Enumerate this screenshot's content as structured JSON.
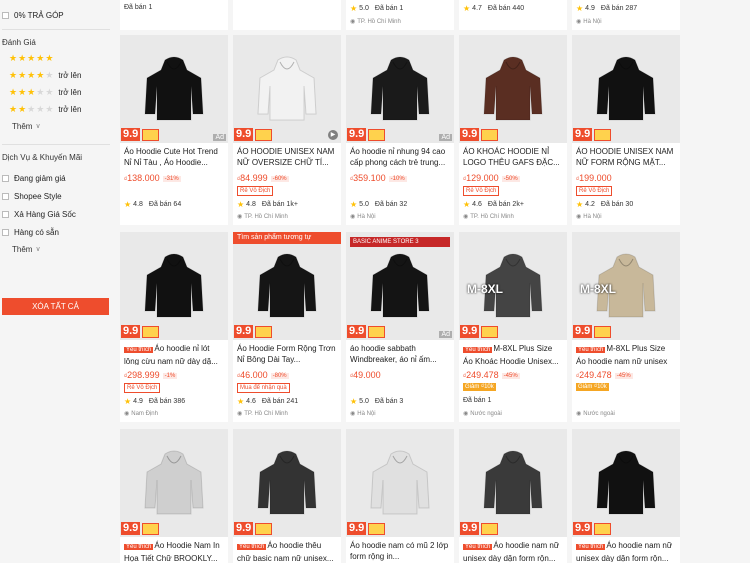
{
  "sidebar": {
    "tra_gop": "0% TRẢ GÓP",
    "rating_title": "Đánh Giá",
    "ratings": [
      {
        "stars": 5,
        "label": ""
      },
      {
        "stars": 4,
        "label": "trở lên"
      },
      {
        "stars": 3,
        "label": "trở lên"
      },
      {
        "stars": 2,
        "label": "trở lên"
      }
    ],
    "more_label": "Thêm",
    "services_title": "Dịch Vụ & Khuyến Mãi",
    "services": [
      "Đang giảm giá",
      "Shopee Style",
      "Xả Hàng Giá Sốc",
      "Hàng có sẵn"
    ],
    "services_more": "Thêm",
    "clear_all": "XÓA TẤT CẢ",
    "accent": "#ee4d2d"
  },
  "top_row": [
    {
      "rating": "",
      "sold": "Đã bán 1",
      "location": ""
    },
    {
      "rating": "5.0",
      "sold": "Đã bán 1",
      "location": "TP. Hồ Chí Minh"
    },
    {
      "rating": "4.7",
      "sold": "Đã bán 440",
      "location": ""
    },
    {
      "rating": "4.9",
      "sold": "Đã bán 287",
      "location": "Hà Nội"
    }
  ],
  "products": [
    {
      "title": "Áo Hoodie Cute Hot Trend Nỉ Nỉ Tàu , Áo Hoodie...",
      "mall": false,
      "price": "138.000",
      "discount": "-31%",
      "tag": "",
      "tag_style": "",
      "rating": "4.8",
      "sold": "Đã bán 64",
      "location": "",
      "banner": "",
      "overlay": "ad",
      "color": "#111"
    },
    {
      "title": "ÁO HOODIE UNISEX NAM NỮ OVERSIZE CHỮ TÍ...",
      "mall": false,
      "price": "84.999",
      "discount": "-60%",
      "tag": "Rẻ Vô Địch",
      "tag_style": "box",
      "rating": "4.8",
      "sold": "Đã bán 1k+",
      "location": "TP. Hồ Chí Minh",
      "banner": "",
      "overlay": "play",
      "color": "#f2f2f2"
    },
    {
      "title": "Áo hoodie nỉ nhung 94 cao cấp phong cách trẻ trung...",
      "mall": false,
      "price": "359.100",
      "discount": "-10%",
      "tag": "",
      "tag_style": "",
      "rating": "5.0",
      "sold": "Đã bán 32",
      "location": "Hà Nội",
      "banner": "",
      "overlay": "ad",
      "color": "#1a1a1a"
    },
    {
      "title": "ÁO KHOÁC HOODIE NỈ LOGO THÊU GAFS ĐẶC...",
      "mall": false,
      "price": "129.000",
      "discount": "-50%",
      "tag": "Rẻ Vô Địch",
      "tag_style": "box",
      "rating": "4.6",
      "sold": "Đã bán 2k+",
      "location": "TP. Hồ Chí Minh",
      "banner": "",
      "overlay": "",
      "color": "#5a2e22"
    },
    {
      "title": "ÁO HOODIE UNISEX NAM NỮ FORM RỘNG MẶT...",
      "mall": false,
      "price": "199.000",
      "discount": "",
      "tag": "Rẻ Vô Địch",
      "tag_style": "box",
      "rating": "4.2",
      "sold": "Đã bán 30",
      "location": "Hà Nội",
      "banner": "",
      "overlay": "",
      "color": "#111"
    },
    {
      "title": "Áo hoodie nỉ lót lông cừu nam nữ dày dặ...",
      "mall": true,
      "price": "298.999",
      "discount": "-1%",
      "tag": "Rẻ Vô Địch",
      "tag_style": "box",
      "rating": "4.9",
      "sold": "Đã bán 386",
      "location": "Nam Định",
      "banner": "",
      "overlay": "",
      "color": "#111"
    },
    {
      "title": "Áo Hoodie Form Rộng Trơn Nỉ Bông Dài Tay...",
      "mall": false,
      "price": "46.000",
      "discount": "-80%",
      "tag": "Mua để nhận quà",
      "tag_style": "box",
      "rating": "4.6",
      "sold": "Đã bán 241",
      "location": "TP. Hồ Chí Minh",
      "banner": "Tìm sản phẩm tương tự",
      "overlay": "",
      "color": "#151515"
    },
    {
      "title": "áo hoodie sabbath Windbreaker, áo nỉ ấm...",
      "mall": false,
      "price": "49.000",
      "discount": "",
      "tag": "",
      "tag_style": "",
      "rating": "5.0",
      "sold": "Đã bán 3",
      "location": "Hà Nội",
      "banner": "BASIC ANIME STORE 3",
      "overlay": "ad",
      "color": "#141414"
    },
    {
      "title": "M-8XL Plus Size Áo Khoác Hoodie Unisex...",
      "mall": true,
      "price": "249.478",
      "discount": "-45%",
      "tag": "Giảm ₫10k",
      "tag_style": "fill",
      "rating": "",
      "sold": "Đã bán 1",
      "location": "Nước ngoài",
      "banner": "",
      "overlay": "",
      "size_tag": "M-8XL",
      "color": "#444"
    },
    {
      "title": "M-8XL Plus Size Áo hoodie nam nữ unisex có mũ trùm đầ...",
      "mall": true,
      "price": "249.478",
      "discount": "-45%",
      "tag": "Giảm ₫10k",
      "tag_style": "fill",
      "rating": "",
      "sold": "",
      "location": "Nước ngoài",
      "banner": "",
      "overlay": "",
      "size_tag": "M-8XL",
      "color": "#c8b89a"
    },
    {
      "title": "Áo Hoodie Nam In Họa Tiết Chữ BROOKLY...",
      "mall": true,
      "price": "",
      "discount": "",
      "tag": "",
      "tag_style": "",
      "rating": "",
      "sold": "",
      "location": "",
      "banner": "",
      "overlay": "",
      "color": "#cfcfcf"
    },
    {
      "title": "Áo hoodie thêu chữ basic nam nữ unisex...",
      "mall": true,
      "price": "",
      "discount": "",
      "tag": "",
      "tag_style": "",
      "rating": "",
      "sold": "",
      "location": "",
      "banner": "",
      "overlay": "",
      "color": "#333"
    },
    {
      "title": "Áo hoodie nam có mũ 2 lớp form rộng in...",
      "mall": false,
      "price": "",
      "discount": "",
      "tag": "",
      "tag_style": "",
      "rating": "",
      "sold": "",
      "location": "",
      "banner": "",
      "overlay": "",
      "color": "#e0e0e0"
    },
    {
      "title": "Áo hoodie nam nữ unisex dày dặn form rộn...",
      "mall": true,
      "price": "",
      "discount": "",
      "tag": "",
      "tag_style": "",
      "rating": "",
      "sold": "",
      "location": "",
      "banner": "",
      "overlay": "",
      "color": "#3a3a3a"
    },
    {
      "title": "Áo hoodie nam nữ unisex dày dặn form rộn...",
      "mall": true,
      "price": "",
      "discount": "",
      "tag": "",
      "tag_style": "",
      "rating": "",
      "sold": "",
      "location": "",
      "banner": "",
      "overlay": "",
      "color": "#111"
    }
  ],
  "labels": {
    "mall": "Yêu thích",
    "badge": "9.9",
    "currency": "₫",
    "ad": "Ad",
    "play": "▶"
  }
}
